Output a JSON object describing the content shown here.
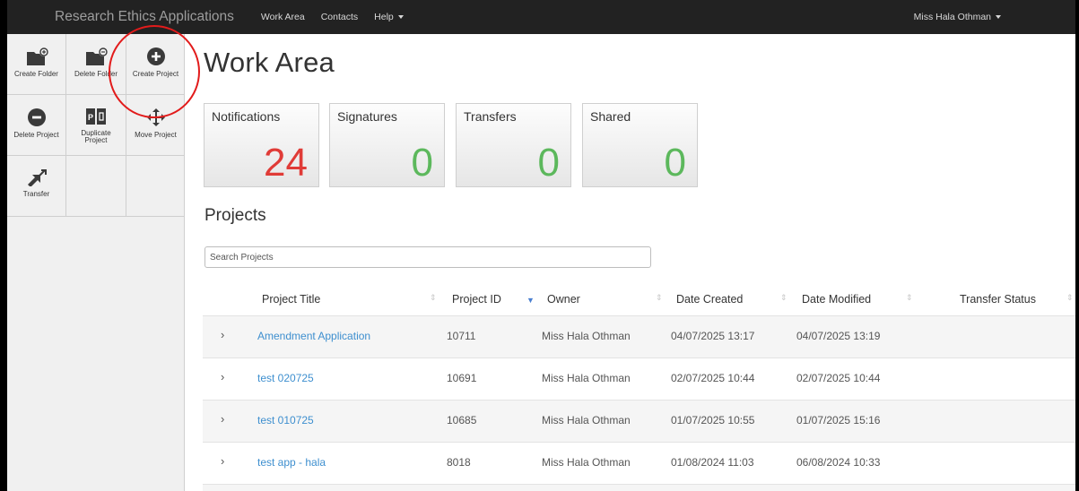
{
  "navbar": {
    "brand": "Research Ethics Applications",
    "links": [
      "Work Area",
      "Contacts",
      "Help"
    ],
    "user": "Miss Hala Othman"
  },
  "toolbar": {
    "create_folder": "Create Folder",
    "delete_folder": "Delete Folder",
    "create_project": "Create Project",
    "delete_project": "Delete Project",
    "duplicate_project": "Duplicate Project",
    "move_project": "Move Project",
    "transfer": "Transfer"
  },
  "page": {
    "title": "Work Area"
  },
  "tiles": [
    {
      "label": "Notifications",
      "count": "24",
      "color": "#e03b37"
    },
    {
      "label": "Signatures",
      "count": "0",
      "color": "#5cb85c"
    },
    {
      "label": "Transfers",
      "count": "0",
      "color": "#5cb85c"
    },
    {
      "label": "Shared",
      "count": "0",
      "color": "#5cb85c"
    }
  ],
  "projects": {
    "title": "Projects",
    "search_placeholder": "Search Projects",
    "columns": [
      "Project Title",
      "Project ID",
      "Owner",
      "Date Created",
      "Date Modified",
      "Transfer Status"
    ],
    "sorted_column": "Project ID",
    "rows": [
      {
        "title": "Amendment Application",
        "id": "10711",
        "owner": "Miss Hala Othman",
        "created": "04/07/2025 13:17",
        "modified": "04/07/2025 13:19",
        "transfer": ""
      },
      {
        "title": "test 020725",
        "id": "10691",
        "owner": "Miss Hala Othman",
        "created": "02/07/2025 10:44",
        "modified": "02/07/2025 10:44",
        "transfer": ""
      },
      {
        "title": "test 010725",
        "id": "10685",
        "owner": "Miss Hala Othman",
        "created": "01/07/2025 10:55",
        "modified": "01/07/2025 15:16",
        "transfer": ""
      },
      {
        "title": "test app - hala",
        "id": "8018",
        "owner": "Miss Hala Othman",
        "created": "01/08/2024 11:03",
        "modified": "06/08/2024 10:33",
        "transfer": ""
      }
    ]
  },
  "colors": {
    "navbar": "#222222",
    "link": "#3e8fcf",
    "count_red": "#e03b37",
    "count_green": "#5cb85c",
    "annotation": "#e21b1b"
  }
}
